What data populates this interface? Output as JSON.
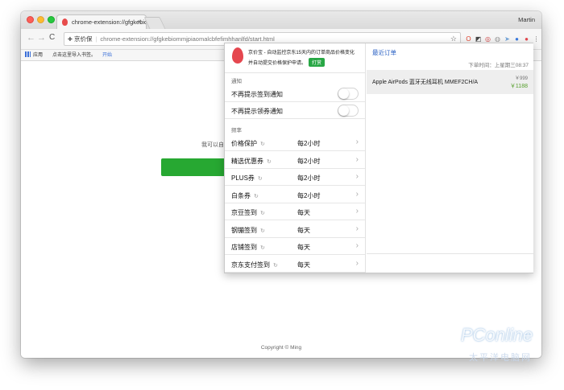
{
  "browser": {
    "tab_title": "chrome-extension://gfgkebiom",
    "tab_close": "×",
    "user": "Martin",
    "back": "←",
    "forward": "→",
    "reload": "C",
    "site_name": "京价保",
    "url": "chrome-extension://gfgkebiommjpiaomalcbfefimhhanlfd/start.html",
    "star": "☆",
    "extensions": [
      {
        "name": "opera-icon",
        "glyph": "O",
        "color": "#e0402b"
      },
      {
        "name": "tampermonkey-icon",
        "glyph": "◩",
        "color": "#444444"
      },
      {
        "name": "chrome-cast-icon",
        "glyph": "◎",
        "color": "#d04040"
      },
      {
        "name": "circle-ext-icon",
        "glyph": "◍",
        "color": "#999999"
      },
      {
        "name": "send-icon",
        "glyph": "➤",
        "color": "#6fa2d8"
      },
      {
        "name": "blue-ext-icon",
        "glyph": "●",
        "color": "#3a7ae0"
      },
      {
        "name": "jjb-ext-icon",
        "glyph": "●",
        "color": "#e5474f"
      },
      {
        "name": "menu-icon",
        "glyph": "⋮",
        "color": "#555555"
      }
    ],
    "bookmarks": {
      "apps_label": "应用",
      "hint": "点击这里导入书签。",
      "start": "开始"
    }
  },
  "page": {
    "hint": "我可以自",
    "copyright": "Copyright © Ming"
  },
  "popup": {
    "header_line1": "京价宝 - 自动监控京东15天内的订单商品价格变化",
    "header_line2": "并自动提交价格保护申请。",
    "rate_label": "打赏",
    "notify_section": "通知",
    "toggles": [
      {
        "label": "不再提示签到通知",
        "on": false
      },
      {
        "label": "不再提示领券通知",
        "on": false
      }
    ],
    "frequency_section": "频率",
    "tasks": [
      {
        "label": "价格保护",
        "value": "每2小时"
      },
      {
        "label": "精选优惠券",
        "value": "每2小时"
      },
      {
        "label": "PLUS券",
        "value": "每2小时"
      },
      {
        "label": "白条券",
        "value": "每2小时"
      },
      {
        "label": "京豆签到",
        "value": "每天"
      },
      {
        "label": "钢镚签到",
        "value": "每天"
      },
      {
        "label": "店铺签到",
        "value": "每天"
      },
      {
        "label": "京东支付签到",
        "value": "每天"
      }
    ],
    "recent_orders_label": "最近订单",
    "order_time_label": "下单时间：",
    "order_time": "上星期三08:37",
    "order": {
      "name": "Apple AirPods 蓝牙无线耳机 MMEF2CH/A",
      "original_price": "￥999",
      "price": "￥1188"
    }
  },
  "watermark": {
    "brand": "PConline",
    "sub": "太平洋电脑网"
  }
}
